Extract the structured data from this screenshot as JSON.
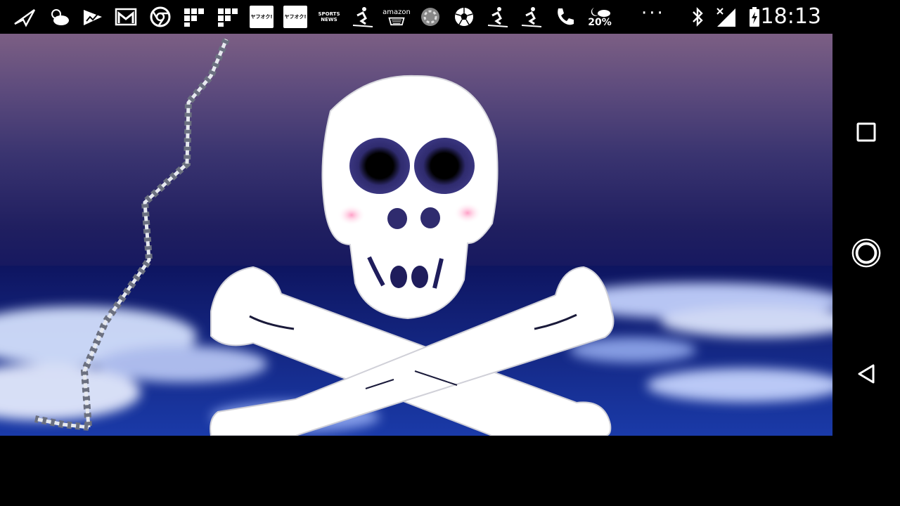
{
  "status_bar": {
    "time": "18:13",
    "icons": [
      "paper-plane-icon",
      "weather-icon",
      "stocks-icon",
      "gmail-icon",
      "chrome-icon",
      "app-grid-icon",
      "app-grid-icon",
      "yahoo-icon",
      "yahoo-icon",
      "sports-news-icon",
      "ski-icon",
      "amazon-icon",
      "loading-icon",
      "soccer-ball-icon",
      "ski-icon",
      "ski-icon",
      "phone-icon",
      "weather-icon"
    ],
    "weather_percent": "20%",
    "overflow": "···",
    "sign_amazon": "amazon",
    "sign_sports": "SPORTS NEWS",
    "yahoo_label": "ヤフオク!",
    "right_icons": [
      "bluetooth-icon",
      "signal-icon",
      "battery-icon"
    ]
  },
  "nav_bar": {
    "buttons": [
      "recents-button",
      "home-button",
      "back-button"
    ]
  },
  "colors": {
    "sky_top": "#7c5f84",
    "sky_mid": "#201f60",
    "sea": "#14288e",
    "bone": "#ffffff",
    "eye": "#2f2b6e"
  }
}
